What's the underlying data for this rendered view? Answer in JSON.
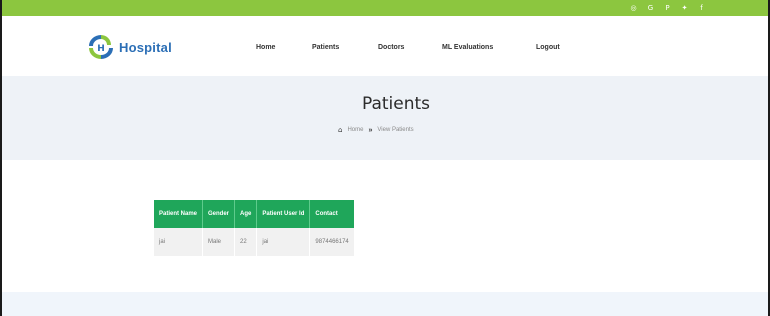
{
  "brand": {
    "name": "Hospital",
    "colors": {
      "top_strip": "#8cc63f",
      "table_header": "#1fa65a",
      "logo_blue": "#2c6fb6",
      "logo_green": "#8cc63f"
    }
  },
  "social_icons": [
    "instagram-icon",
    "google-plus-icon",
    "pinterest-icon",
    "twitter-icon",
    "facebook-icon"
  ],
  "nav": {
    "items": [
      "Home",
      "Patients",
      "Doctors",
      "ML Evaluations",
      "Logout"
    ]
  },
  "page": {
    "title": "Patients",
    "breadcrumb": {
      "home": "Home",
      "current": "View Patients"
    }
  },
  "table": {
    "headers": [
      "Patient Name",
      "Gender",
      "Age",
      "Patient User Id",
      "Contact"
    ],
    "rows": [
      [
        "jai",
        "Male",
        "22",
        "jai",
        "9874466174"
      ]
    ]
  }
}
